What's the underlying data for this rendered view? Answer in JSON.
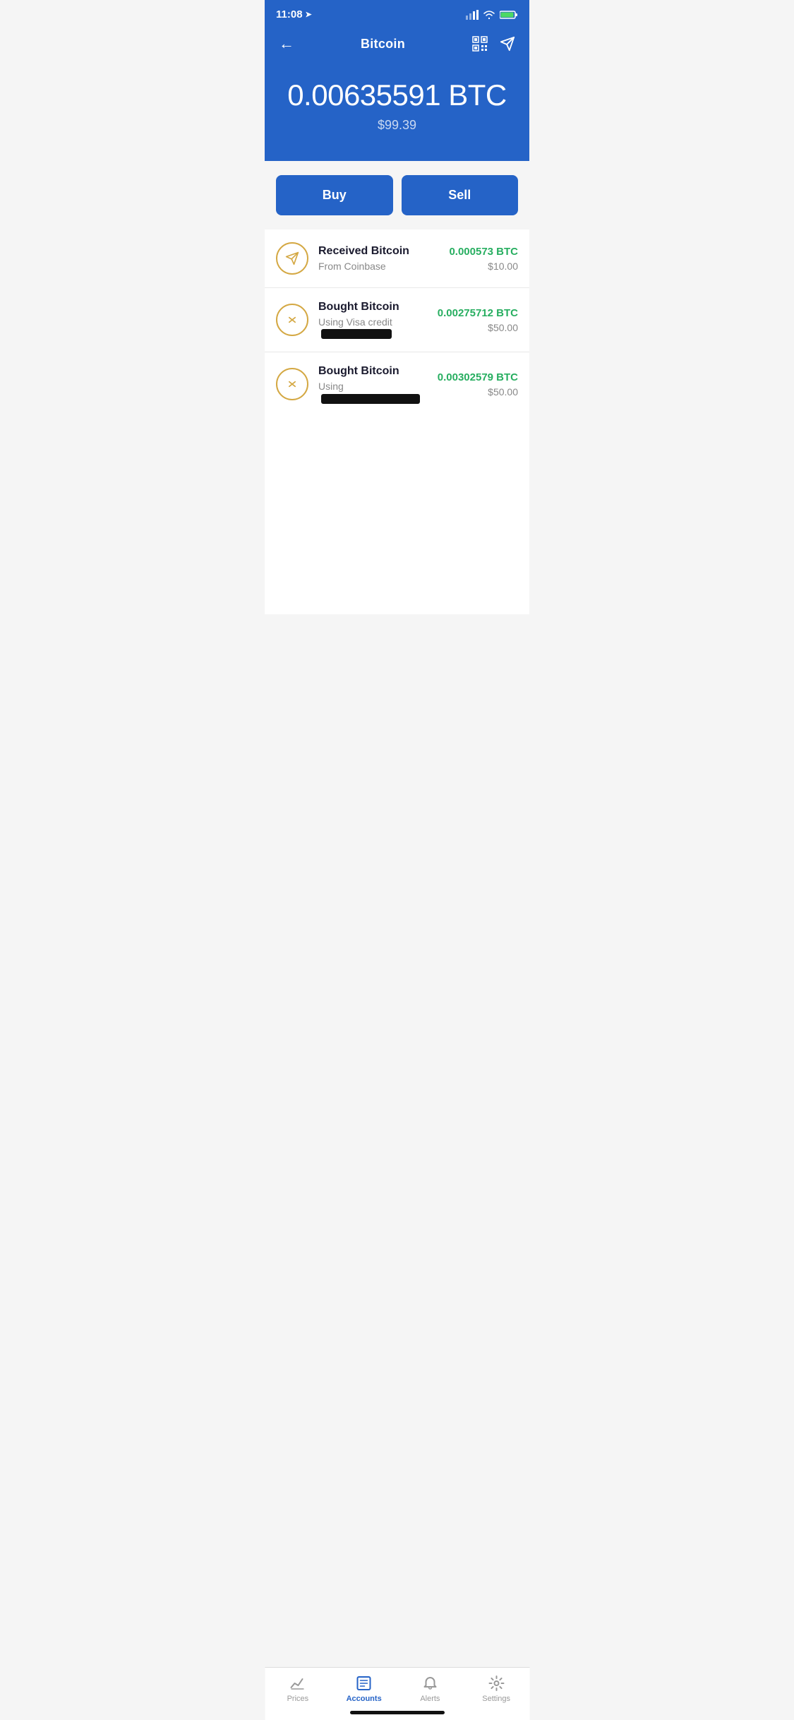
{
  "statusBar": {
    "time": "11:08",
    "locationIcon": "➤"
  },
  "header": {
    "backLabel": "←",
    "title": "Bitcoin",
    "sendLabel": "➤"
  },
  "balance": {
    "btc": "0.00635591 BTC",
    "usd": "$99.39"
  },
  "actions": {
    "buyLabel": "Buy",
    "sellLabel": "Sell"
  },
  "transactions": [
    {
      "type": "receive",
      "title": "Received Bitcoin",
      "subtitle": "From Coinbase",
      "btcAmount": "0.000573 BTC",
      "usdAmount": "$10.00",
      "redacted": false
    },
    {
      "type": "buy",
      "title": "Bought Bitcoin",
      "subtitle": "Using Visa credit",
      "btcAmount": "0.00275712 BTC",
      "usdAmount": "$50.00",
      "redacted": true
    },
    {
      "type": "buy",
      "title": "Bought Bitcoin",
      "subtitle": "Using",
      "btcAmount": "0.00302579 BTC",
      "usdAmount": "$50.00",
      "redacted": true
    }
  ],
  "bottomTabs": [
    {
      "id": "prices",
      "label": "Prices",
      "icon": "📈",
      "active": false
    },
    {
      "id": "accounts",
      "label": "Accounts",
      "icon": "📋",
      "active": true
    },
    {
      "id": "alerts",
      "label": "Alerts",
      "icon": "🔔",
      "active": false
    },
    {
      "id": "settings",
      "label": "Settings",
      "icon": "⚙️",
      "active": false
    }
  ]
}
